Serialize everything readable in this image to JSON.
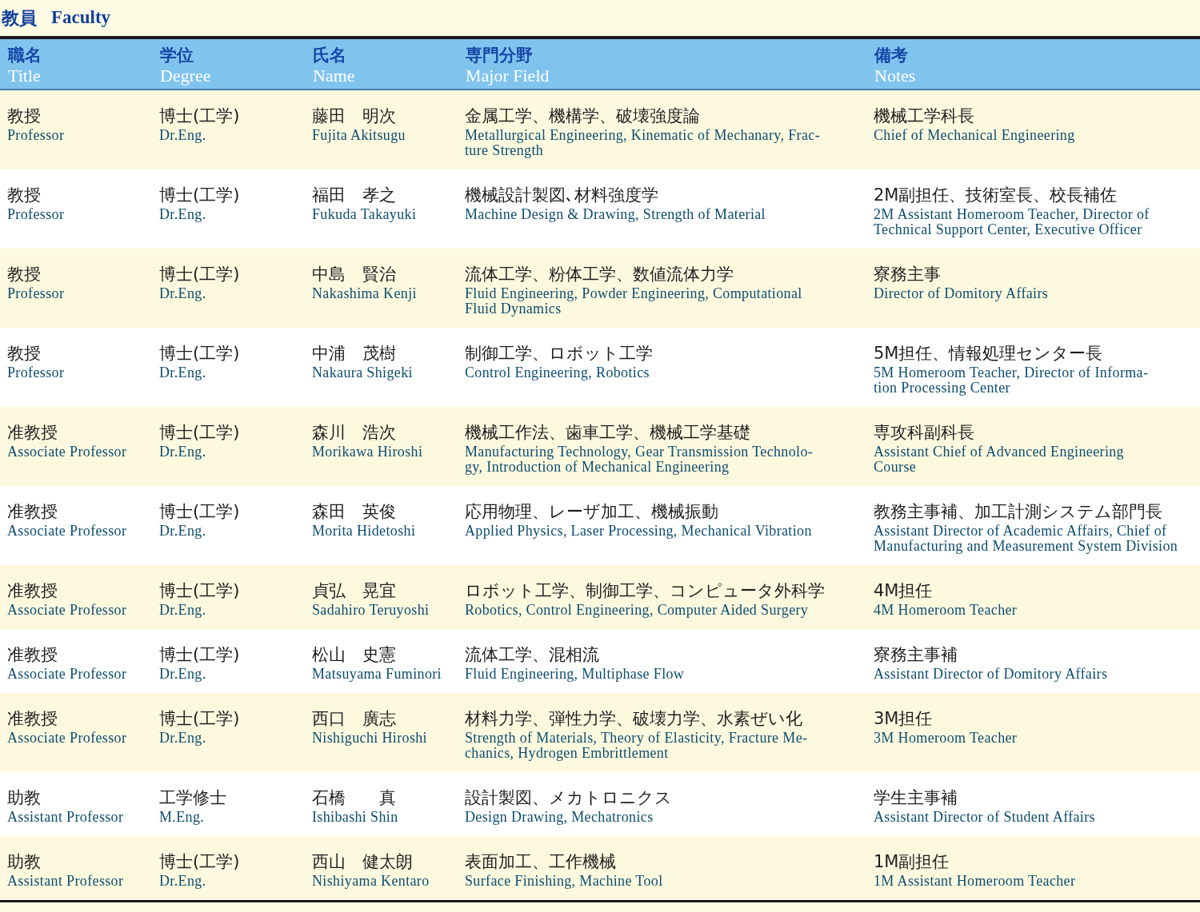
{
  "heading": {
    "jp": "教員",
    "en": "Faculty"
  },
  "columns": [
    {
      "jp": "職名",
      "en": "Title"
    },
    {
      "jp": "学位",
      "en": "Degree"
    },
    {
      "jp": "氏名",
      "en": "Name"
    },
    {
      "jp": "専門分野",
      "en": "Major Field"
    },
    {
      "jp": "備考",
      "en": "Notes"
    }
  ],
  "rows": [
    [
      {
        "jp": "教授",
        "en": "Professor"
      },
      {
        "jp": "博士(工学)",
        "en": "Dr.Eng."
      },
      {
        "jp": "藤田　明次",
        "en": "Fujita Akitsugu"
      },
      {
        "jp": "金属工学、機構学、破壊強度論",
        "en": "Metallurgical Engineering, Kinematic of Mechanary, Frac-\nture Strength"
      },
      {
        "jp": "機械工学科長",
        "en": "Chief of Mechanical Engineering"
      }
    ],
    [
      {
        "jp": "教授",
        "en": "Professor"
      },
      {
        "jp": "博士(工学)",
        "en": "Dr.Eng."
      },
      {
        "jp": "福田　孝之",
        "en": "Fukuda Takayuki"
      },
      {
        "jp": "機械設計製図､材料強度学",
        "en": "Machine Design & Drawing,  Strength of Material"
      },
      {
        "jp": "2M副担任、技術室長、校長補佐",
        "en": "2M Assistant Homeroom Teacher, Director of\nTechnical Support Center, Executive Officer"
      }
    ],
    [
      {
        "jp": "教授",
        "en": "Professor"
      },
      {
        "jp": "博士(工学)",
        "en": "Dr.Eng."
      },
      {
        "jp": "中島　賢治",
        "en": "Nakashima Kenji"
      },
      {
        "jp": "流体工学、粉体工学、数値流体力学",
        "en": "Fluid Engineering, Powder Engineering, Computational\nFluid Dynamics"
      },
      {
        "jp": "寮務主事",
        "en": "Director of Domitory Affairs"
      }
    ],
    [
      {
        "jp": "教授",
        "en": "Professor"
      },
      {
        "jp": "博士(工学)",
        "en": "Dr.Eng."
      },
      {
        "jp": "中浦　茂樹",
        "en": "Nakaura Shigeki"
      },
      {
        "jp": "制御工学、ロボット工学",
        "en": "Control Engineering, Robotics"
      },
      {
        "jp": "5M担任、情報処理センター長",
        "en": "5M Homeroom Teacher, Director of Informa-\ntion Processing Center"
      }
    ],
    [
      {
        "jp": "准教授",
        "en": "Associate Professor"
      },
      {
        "jp": "博士(工学)",
        "en": "Dr.Eng."
      },
      {
        "jp": "森川　浩次",
        "en": "Morikawa Hiroshi"
      },
      {
        "jp": "機械工作法、歯車工学、機械工学基礎",
        "en": "Manufacturing Technology, Gear Transmission Technolo-\ngy, Introduction of Mechanical Engineering"
      },
      {
        "jp": "専攻科副科長",
        "en": "Assistant Chief of Advanced Engineering\nCourse"
      }
    ],
    [
      {
        "jp": "准教授",
        "en": "Associate Professor"
      },
      {
        "jp": "博士(工学)",
        "en": "Dr.Eng."
      },
      {
        "jp": "森田　英俊",
        "en": "Morita Hidetoshi"
      },
      {
        "jp": "応用物理、レーザ加工、機械振動",
        "en": "Applied Physics, Laser Processing, Mechanical Vibration"
      },
      {
        "jp": "教務主事補、加工計測システム部門長",
        "en": "Assistant Director of Academic Affairs, Chief of\nManufacturing and Measurement System Division"
      }
    ],
    [
      {
        "jp": "准教授",
        "en": "Associate Professor"
      },
      {
        "jp": "博士(工学)",
        "en": "Dr.Eng."
      },
      {
        "jp": "貞弘　晃宜",
        "en": "Sadahiro Teruyoshi"
      },
      {
        "jp": "ロボット工学、制御工学、コンピュータ外科学",
        "en": "Robotics, Control Engineering, Computer Aided Surgery"
      },
      {
        "jp": "4M担任",
        "en": "4M Homeroom Teacher"
      }
    ],
    [
      {
        "jp": "准教授",
        "en": "Associate Professor"
      },
      {
        "jp": "博士(工学)",
        "en": "Dr.Eng."
      },
      {
        "jp": "松山　史憲",
        "en": "Matsuyama Fuminori"
      },
      {
        "jp": "流体工学、混相流",
        "en": "Fluid Engineering, Multiphase Flow"
      },
      {
        "jp": "寮務主事補",
        "en": "Assistant Director of Domitory Affairs"
      }
    ],
    [
      {
        "jp": "准教授",
        "en": "Associate Professor"
      },
      {
        "jp": "博士(工学)",
        "en": "Dr.Eng."
      },
      {
        "jp": "西口　廣志",
        "en": "Nishiguchi Hiroshi"
      },
      {
        "jp": "材料力学、弾性力学、破壊力学、水素ぜい化",
        "en": "Strength of Materials, Theory of Elasticity, Fracture Me-\nchanics, Hydrogen Embrittlement"
      },
      {
        "jp": "3M担任",
        "en": "3M Homeroom Teacher"
      }
    ],
    [
      {
        "jp": "助教",
        "en": "Assistant Professor"
      },
      {
        "jp": "工学修士",
        "en": "M.Eng."
      },
      {
        "jp": "石橋　　真",
        "en": "Ishibashi Shin"
      },
      {
        "jp": "設計製図、メカトロニクス",
        "en": "Design Drawing, Mechatronics"
      },
      {
        "jp": "学生主事補",
        "en": "Assistant Director of Student Affairs"
      }
    ],
    [
      {
        "jp": "助教",
        "en": "Assistant Professor"
      },
      {
        "jp": "博士(工学)",
        "en": "Dr.Eng."
      },
      {
        "jp": "西山　健太朗",
        "en": "Nishiyama Kentaro"
      },
      {
        "jp": "表面加工、工作機械",
        "en": "Surface Finishing, Machine Tool"
      },
      {
        "jp": "1M副担任",
        "en": "1M Assistant Homeroom Teacher"
      }
    ]
  ]
}
